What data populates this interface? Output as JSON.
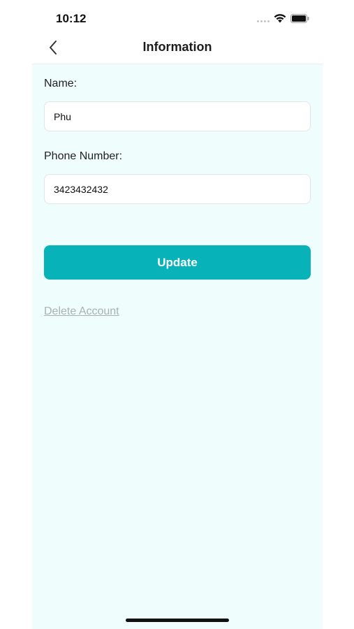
{
  "status_bar": {
    "time": "10:12"
  },
  "nav": {
    "title": "Information",
    "back_icon": "chevron-left-icon"
  },
  "form": {
    "name_label": "Name:",
    "name_value": "Phu",
    "phone_label": "Phone Number:",
    "phone_value": "3423432432"
  },
  "actions": {
    "update_label": "Update",
    "delete_label": "Delete Account"
  },
  "colors": {
    "accent": "#07b3b9",
    "background": "#effdfd",
    "link_muted": "#a9b1b3"
  }
}
